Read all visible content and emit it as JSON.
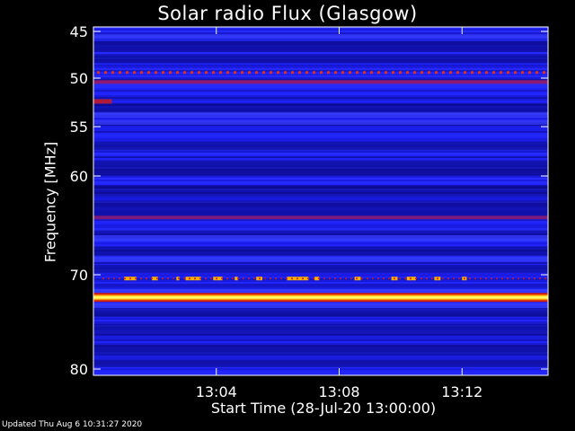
{
  "chart_data": {
    "type": "heatmap",
    "title": "Solar radio Flux (Glasgow)",
    "ylabel": "Frequency [MHz]",
    "xlabel": "Start Time (28-Jul-20 13:00:00)",
    "y_range_mhz": [
      45,
      80
    ],
    "y_ticks": [
      45,
      50,
      55,
      60,
      70,
      80
    ],
    "y_tick_labels": [
      "45",
      "50",
      "55",
      "60",
      "70",
      "80"
    ],
    "x_range_minutes_after_start": [
      0,
      14.8
    ],
    "x_ticks": [
      "13:04",
      "13:08",
      "13:12"
    ],
    "x_tick_minutes": [
      4,
      8,
      12
    ],
    "colormap": "blue-red-yellow",
    "features": [
      {
        "frequency_mhz": 49.4,
        "kind": "dotted narrow band",
        "color": "#e03020"
      },
      {
        "frequency_mhz": 50.4,
        "kind": "narrow band",
        "color": "#a01a5a"
      },
      {
        "frequency_mhz": 52.4,
        "kind": "short segment at start",
        "color": "#b01a3a"
      },
      {
        "frequency_mhz": 64.2,
        "kind": "narrow band",
        "color": "#8a1a6a"
      },
      {
        "frequency_mhz": 70.4,
        "kind": "intermittent bursts",
        "color": "#ffb000"
      },
      {
        "frequency_mhz": 72.4,
        "kind": "strong continuous band",
        "color": "#ffff60"
      }
    ]
  },
  "footer": "Updated Thu Aug  6 10:31:27 2020"
}
